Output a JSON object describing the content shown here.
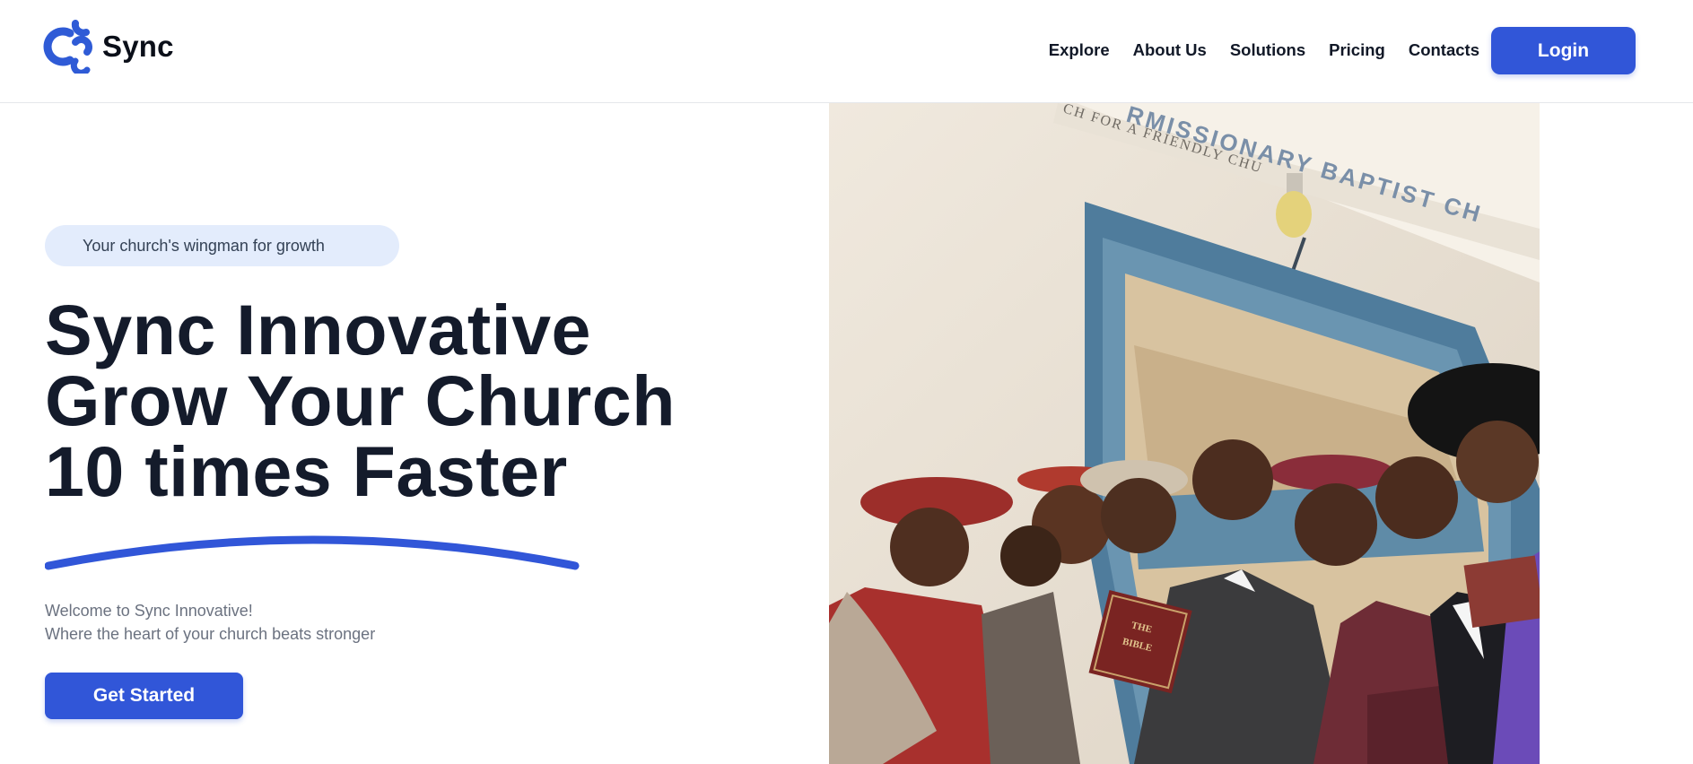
{
  "brand": {
    "name": "Sync",
    "logo_icon": "sync-c-logo-icon",
    "accent_color": "#3156d8"
  },
  "nav": {
    "links": [
      "Explore",
      "About Us",
      "Solutions",
      "Pricing",
      "Contacts"
    ],
    "login_label": "Login"
  },
  "hero": {
    "tagline": "Your church's wingman for growth",
    "headline": [
      "Sync Innovative",
      "Grow Your Church",
      "10 times Faster"
    ],
    "welcome_lines": [
      "Welcome to Sync Innovative!",
      "Where the heart of your church beats stronger"
    ],
    "cta_label": "Get Started",
    "image": {
      "sign_text": "RMISSIONARY BAPTIST CH",
      "sign_subtext": "CH FOR A FRIENDLY CHU",
      "book_text": [
        "THE",
        "BIBLE"
      ]
    }
  }
}
